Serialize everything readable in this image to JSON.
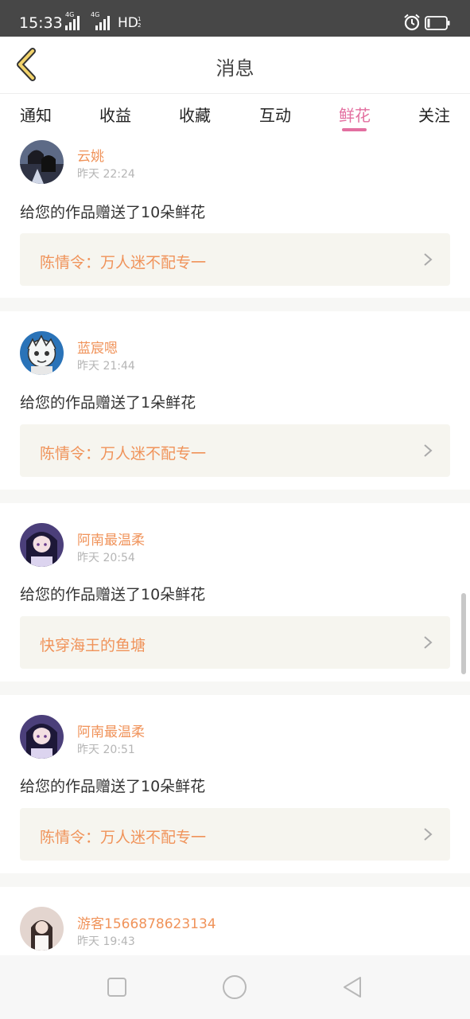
{
  "status": {
    "time": "15:33",
    "signal1": "4G",
    "signal2": "4G",
    "hd": "HD",
    "hd_sub1": "1",
    "hd_sub2": "2"
  },
  "header": {
    "title": "消息"
  },
  "tabs": [
    {
      "label": "通知",
      "active": false
    },
    {
      "label": "收益",
      "active": false
    },
    {
      "label": "收藏",
      "active": false
    },
    {
      "label": "互动",
      "active": false
    },
    {
      "label": "鲜花",
      "active": true
    },
    {
      "label": "关注",
      "active": false
    }
  ],
  "colors": {
    "accent": "#e36fa0",
    "name": "#f0935a",
    "link_bg": "#f6f5ef"
  },
  "items": [
    {
      "username": "云姚",
      "time": "昨天 22:24",
      "message": "给您的作品赠送了10朵鲜花",
      "work": "陈情令：万人迷不配专一",
      "avatar": "avatar-illustrated-pair"
    },
    {
      "username": "蓝宸嗯",
      "time": "昨天 21:44",
      "message": "给您的作品赠送了1朵鲜花",
      "work": "陈情令：万人迷不配专一",
      "avatar": "avatar-cartoon-boy"
    },
    {
      "username": "阿南最温柔",
      "time": "昨天 20:54",
      "message": "给您的作品赠送了10朵鲜花",
      "work": "快穿海王的鱼塘",
      "avatar": "avatar-anime-girl"
    },
    {
      "username": "阿南最温柔",
      "time": "昨天 20:51",
      "message": "给您的作品赠送了10朵鲜花",
      "work": "陈情令：万人迷不配专一",
      "avatar": "avatar-anime-girl"
    },
    {
      "username": "游客1566878623134",
      "time": "昨天 19:43",
      "message": "",
      "work": "",
      "avatar": "avatar-photo-girl"
    }
  ]
}
